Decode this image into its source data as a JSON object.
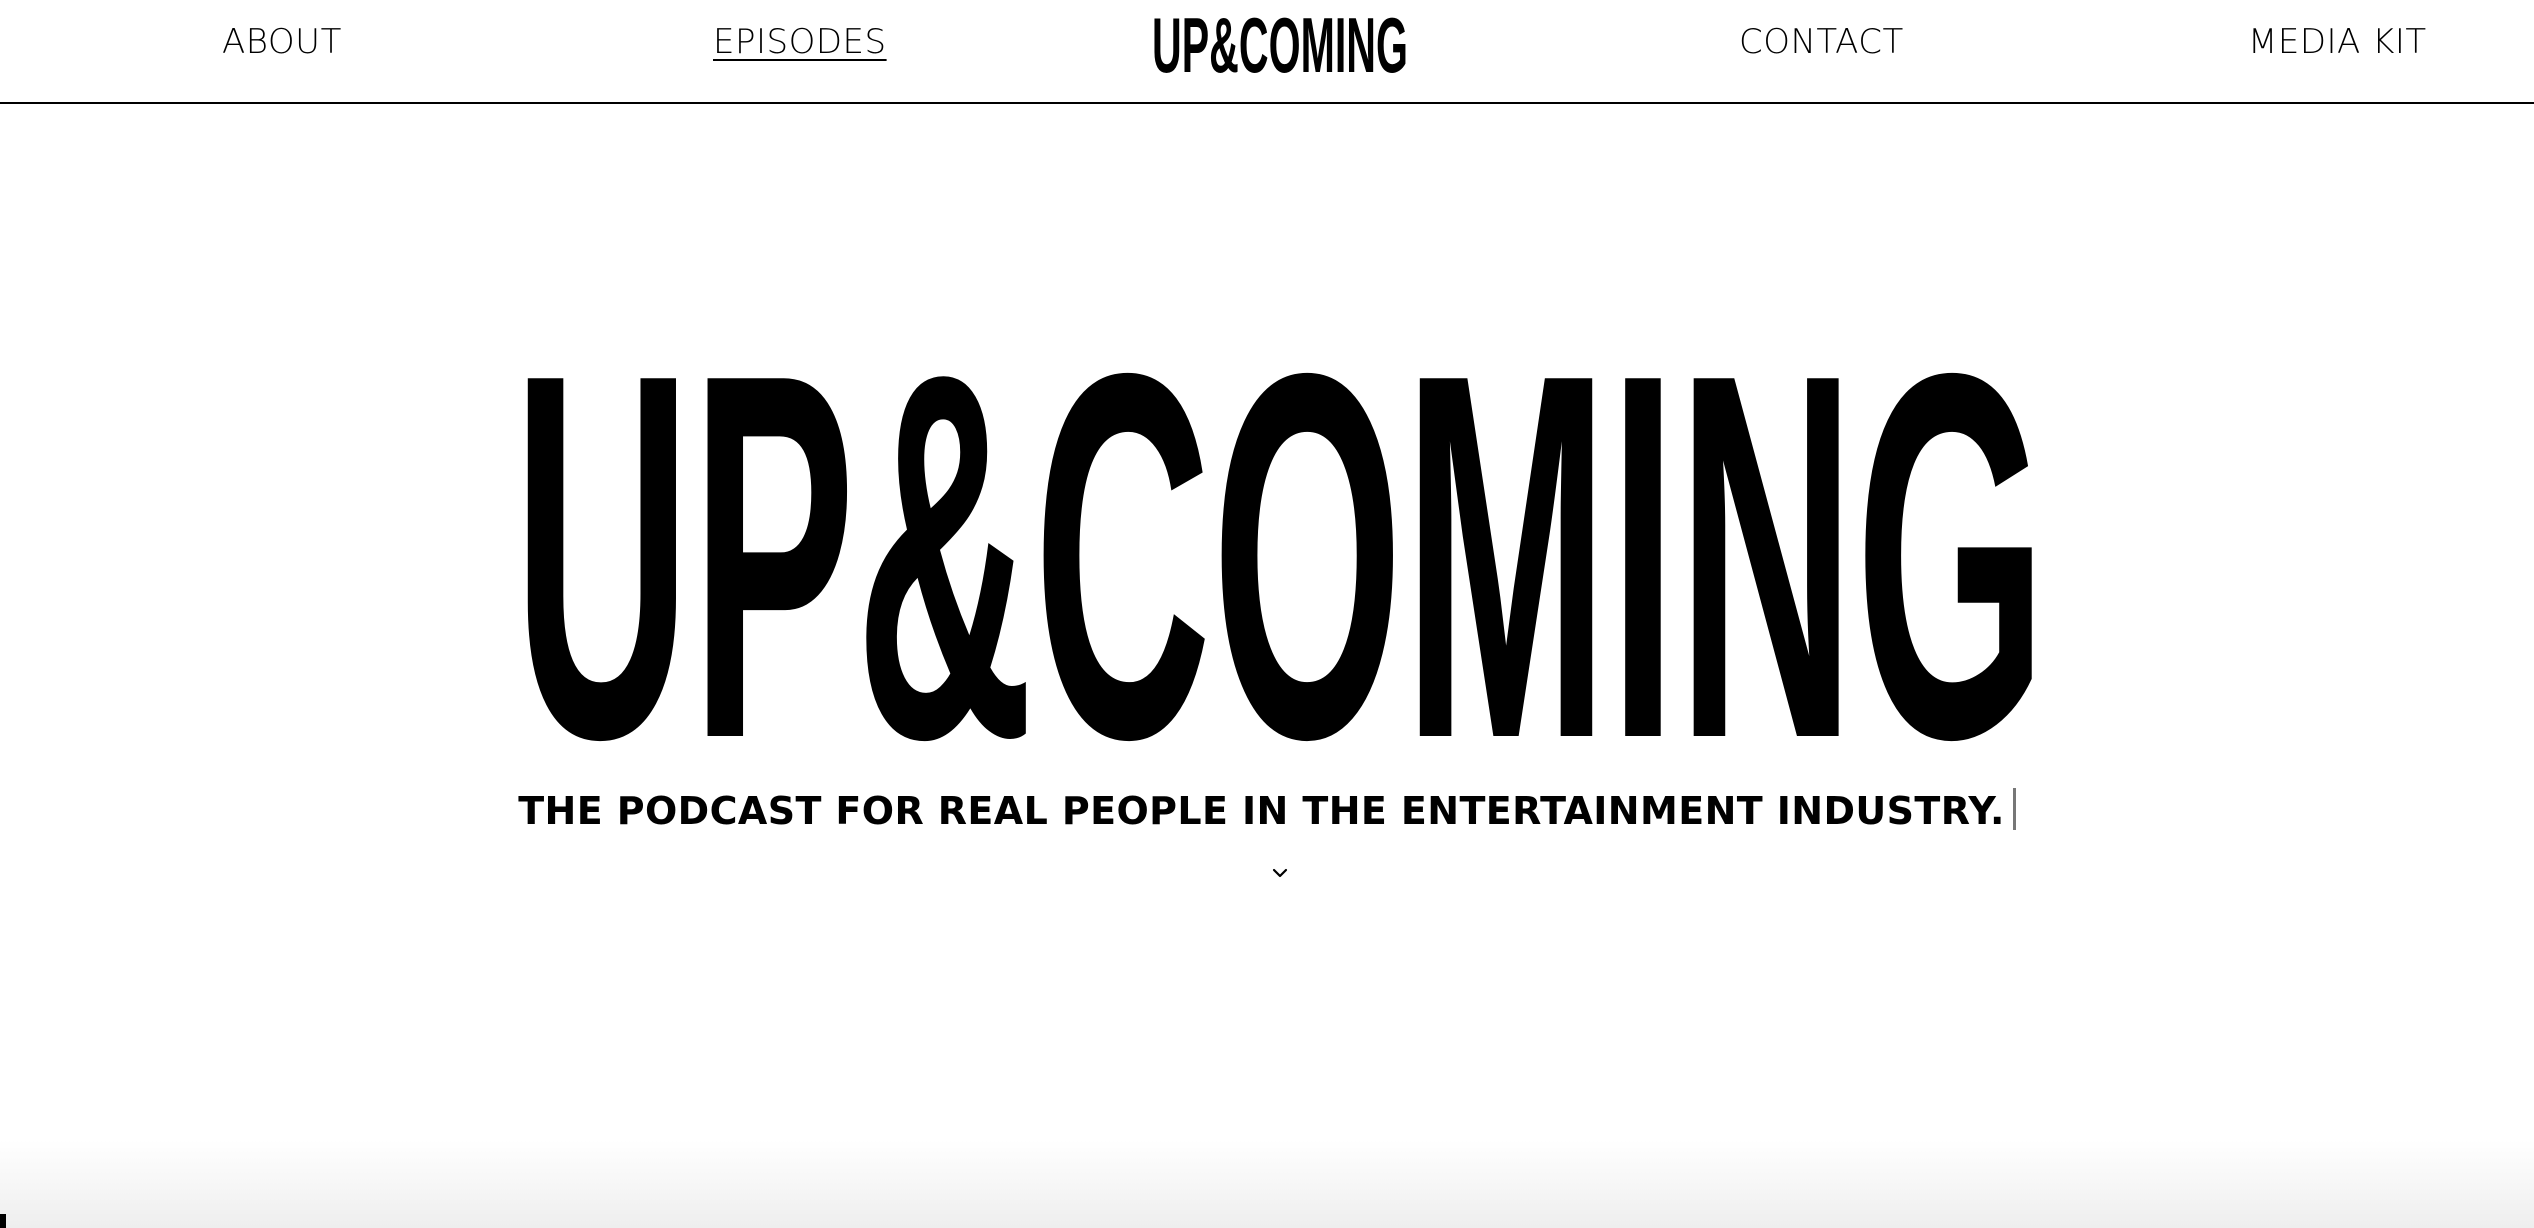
{
  "nav": {
    "items": [
      {
        "label": "ABOUT"
      },
      {
        "label": "EPISODES"
      },
      {
        "label": "CONTACT"
      },
      {
        "label": "MEDIA KIT"
      }
    ],
    "logo_text": "UP&COMING",
    "active": "EPISODES"
  },
  "hero": {
    "logo_text": "UP&COMING",
    "tagline": "THE PODCAST FOR REAL PEOPLE IN THE ENTERTAINMENT INDUSTRY.",
    "scroll_icon": "chevron-down-icon"
  },
  "colors": {
    "text": "#000000",
    "background": "#ffffff",
    "cursor": "#777777"
  }
}
